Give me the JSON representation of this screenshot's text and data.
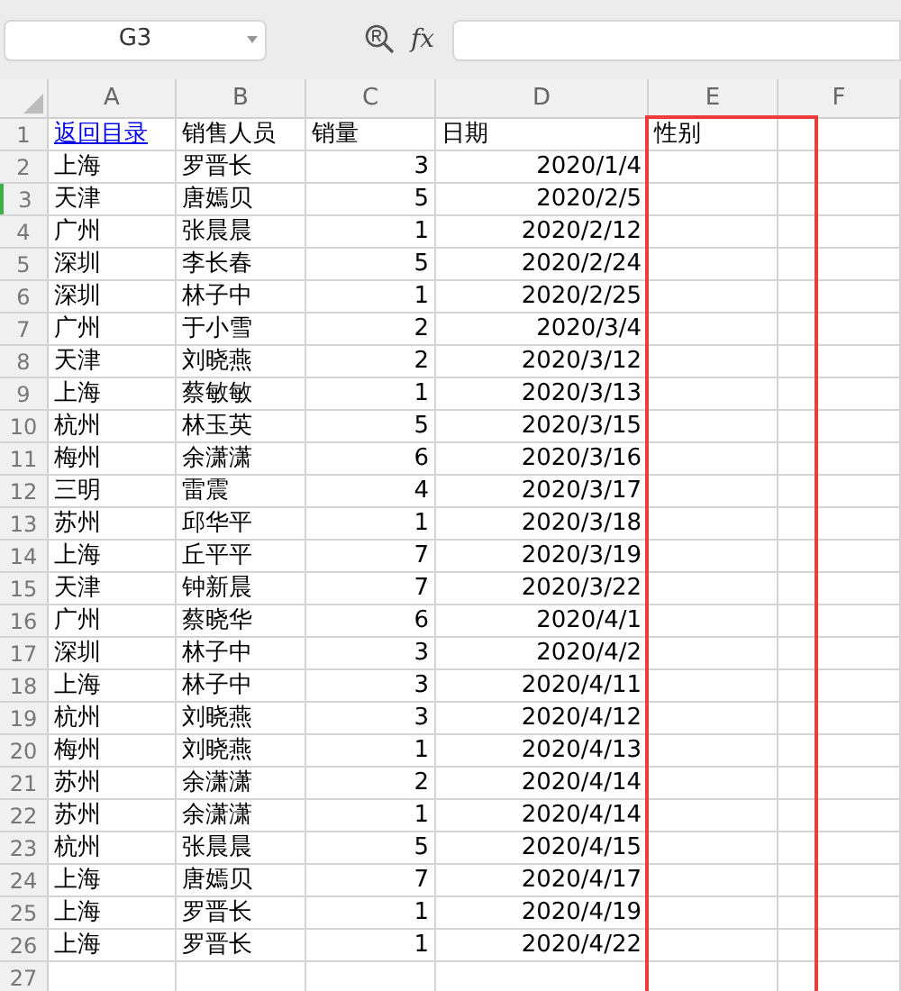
{
  "name_box": {
    "value": "G3"
  },
  "formula_bar": {
    "fx": "fx"
  },
  "columns": [
    {
      "label": "A",
      "highlighted": false
    },
    {
      "label": "B",
      "highlighted": false
    },
    {
      "label": "C",
      "highlighted": false
    },
    {
      "label": "D",
      "highlighted": false
    },
    {
      "label": "E",
      "highlighted": true
    },
    {
      "label": "F",
      "highlighted": false
    }
  ],
  "rows": [
    {
      "number": "1",
      "selected": false,
      "cells": [
        {
          "text": "返回目录",
          "kind": "link"
        },
        {
          "text": "销售人员",
          "kind": "text"
        },
        {
          "text": "销量",
          "kind": "text"
        },
        {
          "text": "日期",
          "kind": "text"
        },
        {
          "text": "性别",
          "kind": "text"
        }
      ]
    },
    {
      "number": "2",
      "selected": false,
      "cells": [
        {
          "text": "上海",
          "kind": "text"
        },
        {
          "text": "罗晋长",
          "kind": "text"
        },
        {
          "text": "3",
          "kind": "number"
        },
        {
          "text": "2020/1/4",
          "kind": "number"
        }
      ]
    },
    {
      "number": "3",
      "selected": true,
      "cells": [
        {
          "text": "天津",
          "kind": "text"
        },
        {
          "text": "唐嫣贝",
          "kind": "text"
        },
        {
          "text": "5",
          "kind": "number"
        },
        {
          "text": "2020/2/5",
          "kind": "number"
        }
      ]
    },
    {
      "number": "4",
      "selected": false,
      "cells": [
        {
          "text": "广州",
          "kind": "text"
        },
        {
          "text": "张晨晨",
          "kind": "text"
        },
        {
          "text": "1",
          "kind": "number"
        },
        {
          "text": "2020/2/12",
          "kind": "number"
        }
      ]
    },
    {
      "number": "5",
      "selected": false,
      "cells": [
        {
          "text": "深圳",
          "kind": "text"
        },
        {
          "text": "李长春",
          "kind": "text"
        },
        {
          "text": "5",
          "kind": "number"
        },
        {
          "text": "2020/2/24",
          "kind": "number"
        }
      ]
    },
    {
      "number": "6",
      "selected": false,
      "cells": [
        {
          "text": "深圳",
          "kind": "text"
        },
        {
          "text": "林子中",
          "kind": "text"
        },
        {
          "text": "1",
          "kind": "number"
        },
        {
          "text": "2020/2/25",
          "kind": "number"
        }
      ]
    },
    {
      "number": "7",
      "selected": false,
      "cells": [
        {
          "text": "广州",
          "kind": "text"
        },
        {
          "text": "于小雪",
          "kind": "text"
        },
        {
          "text": "2",
          "kind": "number"
        },
        {
          "text": "2020/3/4",
          "kind": "number"
        }
      ]
    },
    {
      "number": "8",
      "selected": false,
      "cells": [
        {
          "text": "天津",
          "kind": "text"
        },
        {
          "text": "刘晓燕",
          "kind": "text"
        },
        {
          "text": "2",
          "kind": "number"
        },
        {
          "text": "2020/3/12",
          "kind": "number"
        }
      ]
    },
    {
      "number": "9",
      "selected": false,
      "cells": [
        {
          "text": "上海",
          "kind": "text"
        },
        {
          "text": "蔡敏敏",
          "kind": "text"
        },
        {
          "text": "1",
          "kind": "number"
        },
        {
          "text": "2020/3/13",
          "kind": "number"
        }
      ]
    },
    {
      "number": "10",
      "selected": false,
      "cells": [
        {
          "text": "杭州",
          "kind": "text"
        },
        {
          "text": "林玉英",
          "kind": "text"
        },
        {
          "text": "5",
          "kind": "number"
        },
        {
          "text": "2020/3/15",
          "kind": "number"
        }
      ]
    },
    {
      "number": "11",
      "selected": false,
      "cells": [
        {
          "text": "梅州",
          "kind": "text"
        },
        {
          "text": "余潇潇",
          "kind": "text"
        },
        {
          "text": "6",
          "kind": "number"
        },
        {
          "text": "2020/3/16",
          "kind": "number"
        }
      ]
    },
    {
      "number": "12",
      "selected": false,
      "cells": [
        {
          "text": "三明",
          "kind": "text"
        },
        {
          "text": "雷震",
          "kind": "text"
        },
        {
          "text": "4",
          "kind": "number"
        },
        {
          "text": "2020/3/17",
          "kind": "number"
        }
      ]
    },
    {
      "number": "13",
      "selected": false,
      "cells": [
        {
          "text": "苏州",
          "kind": "text"
        },
        {
          "text": "邱华平",
          "kind": "text"
        },
        {
          "text": "1",
          "kind": "number"
        },
        {
          "text": "2020/3/18",
          "kind": "number"
        }
      ]
    },
    {
      "number": "14",
      "selected": false,
      "cells": [
        {
          "text": "上海",
          "kind": "text"
        },
        {
          "text": "丘平平",
          "kind": "text"
        },
        {
          "text": "7",
          "kind": "number"
        },
        {
          "text": "2020/3/19",
          "kind": "number"
        }
      ]
    },
    {
      "number": "15",
      "selected": false,
      "cells": [
        {
          "text": "天津",
          "kind": "text"
        },
        {
          "text": "钟新晨",
          "kind": "text"
        },
        {
          "text": "7",
          "kind": "number"
        },
        {
          "text": "2020/3/22",
          "kind": "number"
        }
      ]
    },
    {
      "number": "16",
      "selected": false,
      "cells": [
        {
          "text": "广州",
          "kind": "text"
        },
        {
          "text": "蔡晓华",
          "kind": "text"
        },
        {
          "text": "6",
          "kind": "number"
        },
        {
          "text": "2020/4/1",
          "kind": "number"
        }
      ]
    },
    {
      "number": "17",
      "selected": false,
      "cells": [
        {
          "text": "深圳",
          "kind": "text"
        },
        {
          "text": "林子中",
          "kind": "text"
        },
        {
          "text": "3",
          "kind": "number"
        },
        {
          "text": "2020/4/2",
          "kind": "number"
        }
      ]
    },
    {
      "number": "18",
      "selected": false,
      "cells": [
        {
          "text": "上海",
          "kind": "text"
        },
        {
          "text": "林子中",
          "kind": "text"
        },
        {
          "text": "3",
          "kind": "number"
        },
        {
          "text": "2020/4/11",
          "kind": "number"
        }
      ]
    },
    {
      "number": "19",
      "selected": false,
      "cells": [
        {
          "text": "杭州",
          "kind": "text"
        },
        {
          "text": "刘晓燕",
          "kind": "text"
        },
        {
          "text": "3",
          "kind": "number"
        },
        {
          "text": "2020/4/12",
          "kind": "number"
        }
      ]
    },
    {
      "number": "20",
      "selected": false,
      "cells": [
        {
          "text": "梅州",
          "kind": "text"
        },
        {
          "text": "刘晓燕",
          "kind": "text"
        },
        {
          "text": "1",
          "kind": "number"
        },
        {
          "text": "2020/4/13",
          "kind": "number"
        }
      ]
    },
    {
      "number": "21",
      "selected": false,
      "cells": [
        {
          "text": "苏州",
          "kind": "text"
        },
        {
          "text": "余潇潇",
          "kind": "text"
        },
        {
          "text": "2",
          "kind": "number"
        },
        {
          "text": "2020/4/14",
          "kind": "number"
        }
      ]
    },
    {
      "number": "22",
      "selected": false,
      "cells": [
        {
          "text": "苏州",
          "kind": "text"
        },
        {
          "text": "余潇潇",
          "kind": "text"
        },
        {
          "text": "1",
          "kind": "number"
        },
        {
          "text": "2020/4/14",
          "kind": "number"
        }
      ]
    },
    {
      "number": "23",
      "selected": false,
      "cells": [
        {
          "text": "杭州",
          "kind": "text"
        },
        {
          "text": "张晨晨",
          "kind": "text"
        },
        {
          "text": "5",
          "kind": "number"
        },
        {
          "text": "2020/4/15",
          "kind": "number"
        }
      ]
    },
    {
      "number": "24",
      "selected": false,
      "cells": [
        {
          "text": "上海",
          "kind": "text"
        },
        {
          "text": "唐嫣贝",
          "kind": "text"
        },
        {
          "text": "7",
          "kind": "number"
        },
        {
          "text": "2020/4/17",
          "kind": "number"
        }
      ]
    },
    {
      "number": "25",
      "selected": false,
      "cells": [
        {
          "text": "上海",
          "kind": "text"
        },
        {
          "text": "罗晋长",
          "kind": "text"
        },
        {
          "text": "1",
          "kind": "number"
        },
        {
          "text": "2020/4/19",
          "kind": "number"
        }
      ]
    },
    {
      "number": "26",
      "selected": false,
      "cells": [
        {
          "text": "上海",
          "kind": "text"
        },
        {
          "text": "罗晋长",
          "kind": "text"
        },
        {
          "text": "1",
          "kind": "number"
        },
        {
          "text": "2020/4/22",
          "kind": "number"
        }
      ]
    },
    {
      "number": "27",
      "selected": false,
      "cells": []
    }
  ]
}
